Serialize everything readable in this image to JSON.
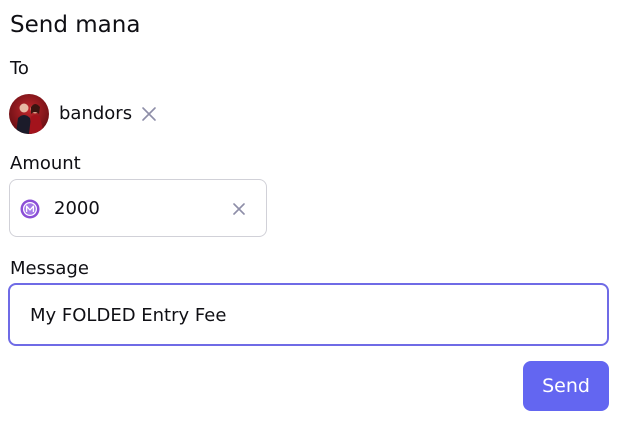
{
  "form": {
    "title": "Send mana",
    "to_label": "To",
    "amount_label": "Amount",
    "message_label": "Message",
    "send_label": "Send"
  },
  "recipient": {
    "name": "bandors",
    "avatar_icon": "user-avatar"
  },
  "amount": {
    "value": "2000",
    "currency_icon": "mana-coin-icon",
    "clear_icon": "close-icon"
  },
  "message": {
    "value": "My FOLDED Entry Fee"
  },
  "colors": {
    "accent": "#6366f1",
    "focus_border": "#6f6be6",
    "icon_muted": "#8e8ea8",
    "mana_purple": "#8b4fd6"
  }
}
